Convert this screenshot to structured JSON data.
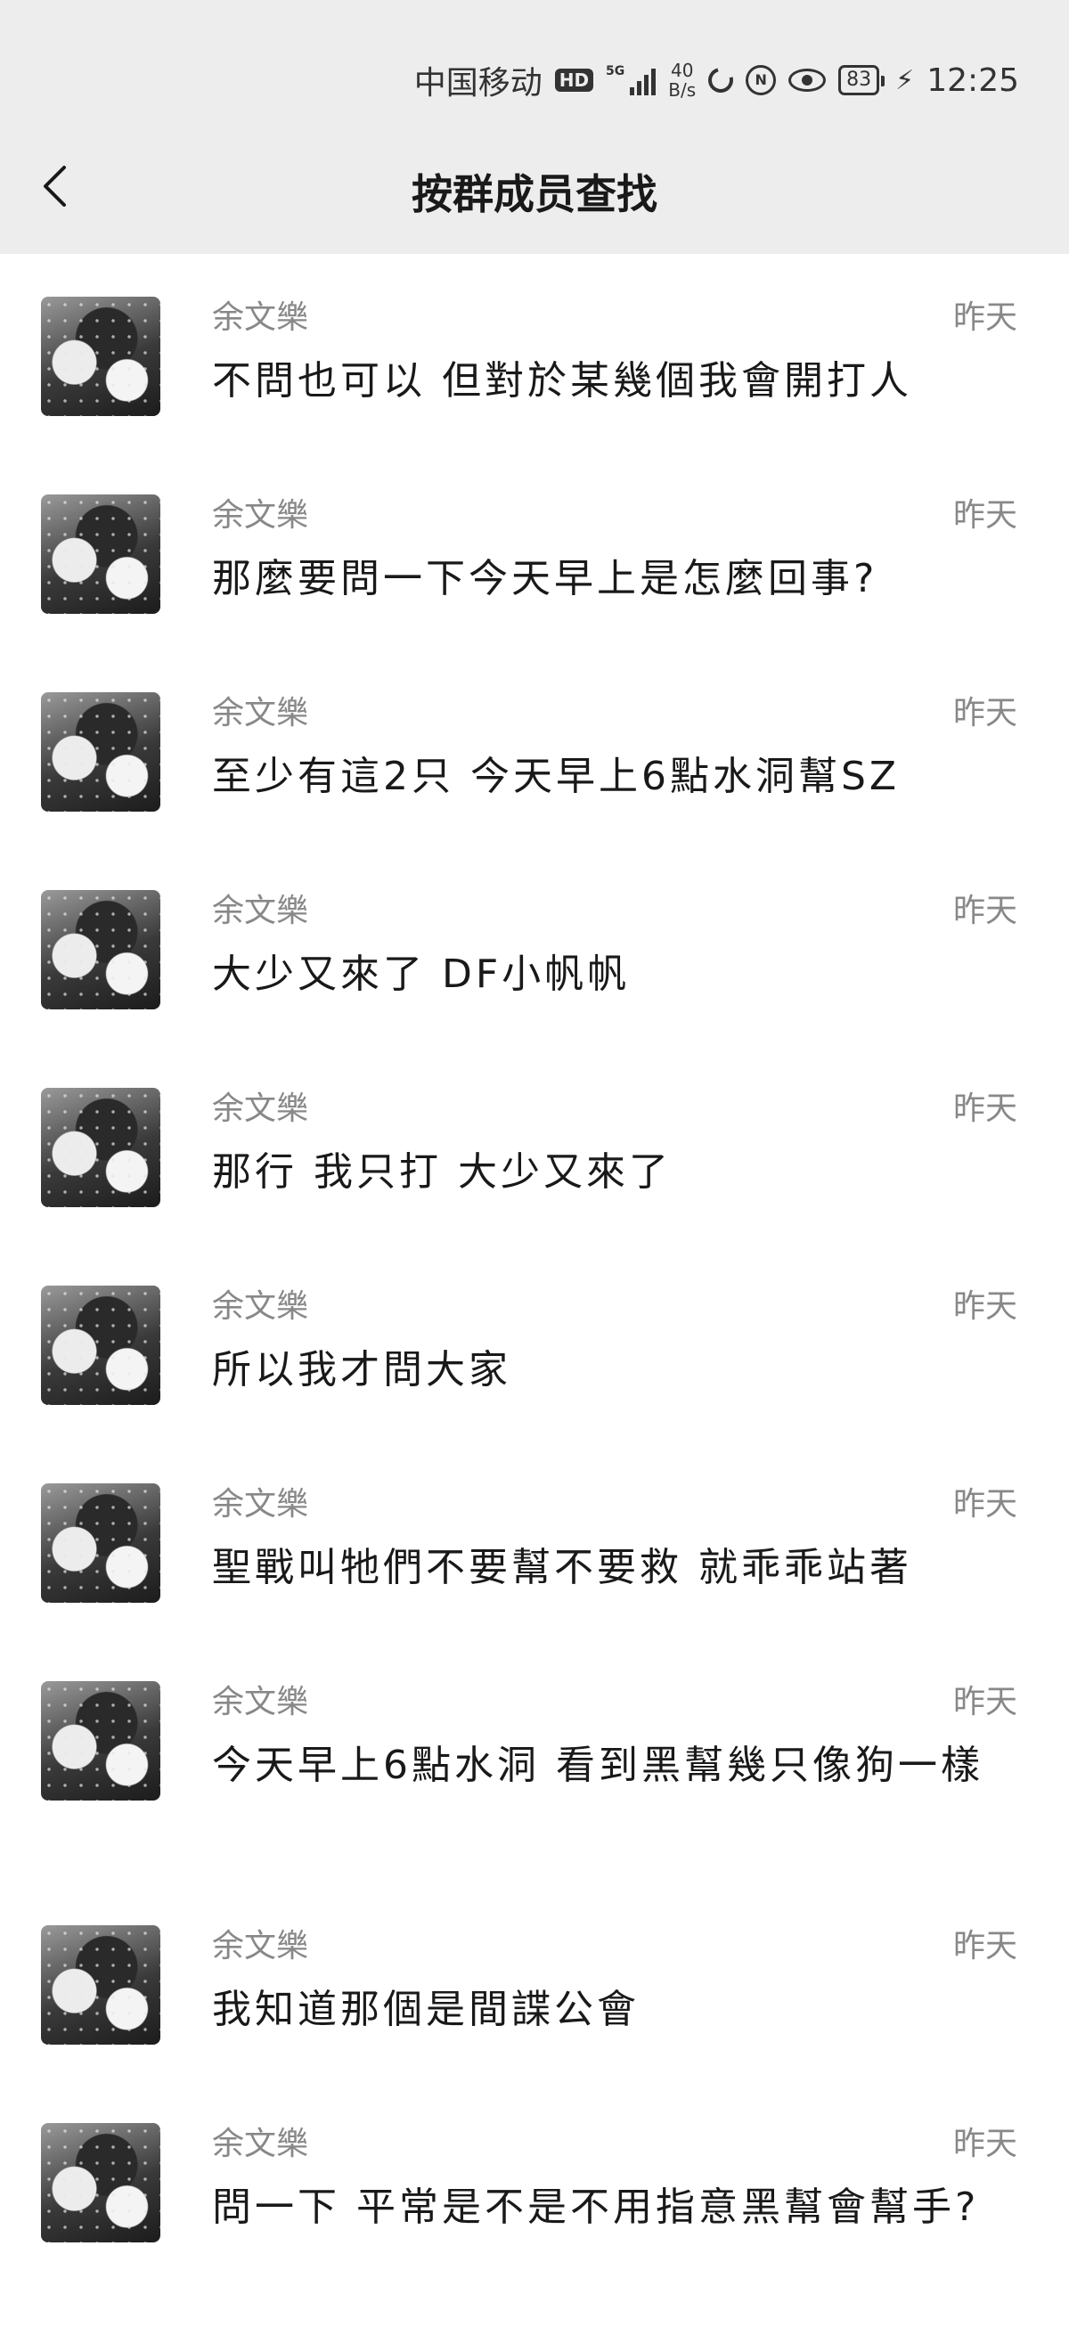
{
  "status_bar": {
    "carrier": "中国移动",
    "hd": "HD",
    "network": "5G",
    "speed_value": "40",
    "speed_unit": "B/s",
    "nfc": "N",
    "battery": "83",
    "time": "12:25"
  },
  "header": {
    "title": "按群成员查找"
  },
  "messages": [
    {
      "name": "余文樂",
      "date": "昨天",
      "text": "不問也可以  但對於某幾個我會開打人"
    },
    {
      "name": "余文樂",
      "date": "昨天",
      "text": "那麼要問一下今天早上是怎麼回事?"
    },
    {
      "name": "余文樂",
      "date": "昨天",
      "text": "至少有這2只 今天早上6點水洞幫SZ"
    },
    {
      "name": "余文樂",
      "date": "昨天",
      "text": "大少又來了   DF小帆帆"
    },
    {
      "name": "余文樂",
      "date": "昨天",
      "text": "那行 我只打 大少又來了"
    },
    {
      "name": "余文樂",
      "date": "昨天",
      "text": "所以我才問大家"
    },
    {
      "name": "余文樂",
      "date": "昨天",
      "text": "聖戰叫牠們不要幫不要救 就乖乖站著"
    },
    {
      "name": "余文樂",
      "date": "昨天",
      "text": "今天早上6點水洞 看到黑幫幾只像狗一樣"
    },
    {
      "name": "余文樂",
      "date": "昨天",
      "text": "我知道那個是間諜公會"
    },
    {
      "name": "余文樂",
      "date": "昨天",
      "text": "問一下 平常是不是不用指意黑幫會幫手?"
    }
  ]
}
